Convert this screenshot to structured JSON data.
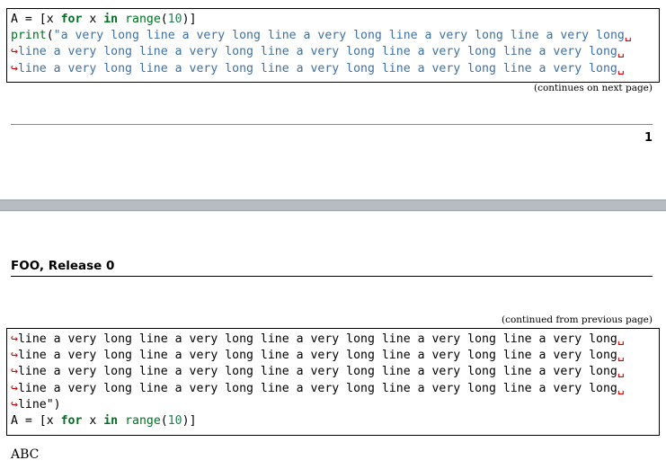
{
  "page1": {
    "code_lines": [
      [
        [
          "A = [x ",
          ""
        ],
        [
          "for",
          "kw"
        ],
        [
          " x ",
          ""
        ],
        [
          "in",
          "kw"
        ],
        [
          " ",
          ""
        ],
        [
          "range",
          "nb"
        ],
        [
          "(",
          ""
        ],
        [
          "10",
          "mi"
        ],
        [
          ")]",
          ""
        ]
      ],
      [
        [
          "print",
          "nb"
        ],
        [
          "(",
          ""
        ],
        [
          "\"a very long line a very long line a very long line a very long line a very long",
          "s"
        ],
        [
          "␣",
          "ar"
        ]
      ],
      [
        [
          "↪",
          "ar"
        ],
        [
          "line a very long line a very long line a very long line a very long line a very long",
          "s"
        ],
        [
          "␣",
          "ar"
        ]
      ],
      [
        [
          "↪",
          "ar"
        ],
        [
          "line a very long line a very long line a very long line a very long line a very long",
          "s"
        ],
        [
          "␣",
          "ar"
        ]
      ]
    ],
    "continues_note": "(continues on next page)",
    "page_number": "1"
  },
  "page2": {
    "header_title": "FOO, Release 0",
    "continued_note": "(continued from previous page)",
    "code_lines": [
      [
        [
          "↪",
          "ar"
        ],
        [
          "line a very long line a very long line a very long line a very long line a very long",
          ""
        ],
        [
          "␣",
          "ar"
        ]
      ],
      [
        [
          "↪",
          "ar"
        ],
        [
          "line a very long line a very long line a very long line a very long line a very long",
          ""
        ],
        [
          "␣",
          "ar"
        ]
      ],
      [
        [
          "↪",
          "ar"
        ],
        [
          "line a very long line a very long line a very long line a very long line a very long",
          ""
        ],
        [
          "␣",
          "ar"
        ]
      ],
      [
        [
          "↪",
          "ar"
        ],
        [
          "line a very long line a very long line a very long line a very long line a very long",
          ""
        ],
        [
          "␣",
          "ar"
        ]
      ],
      [
        [
          "↪",
          "ar"
        ],
        [
          "line\")",
          ""
        ]
      ],
      [
        [
          "A = [x ",
          ""
        ],
        [
          "for",
          "kw"
        ],
        [
          " x ",
          ""
        ],
        [
          "in",
          "kw"
        ],
        [
          " ",
          ""
        ],
        [
          "range",
          "nb"
        ],
        [
          "(",
          ""
        ],
        [
          "10",
          "mi"
        ],
        [
          ")]",
          ""
        ]
      ]
    ],
    "body_text": "ABC"
  }
}
